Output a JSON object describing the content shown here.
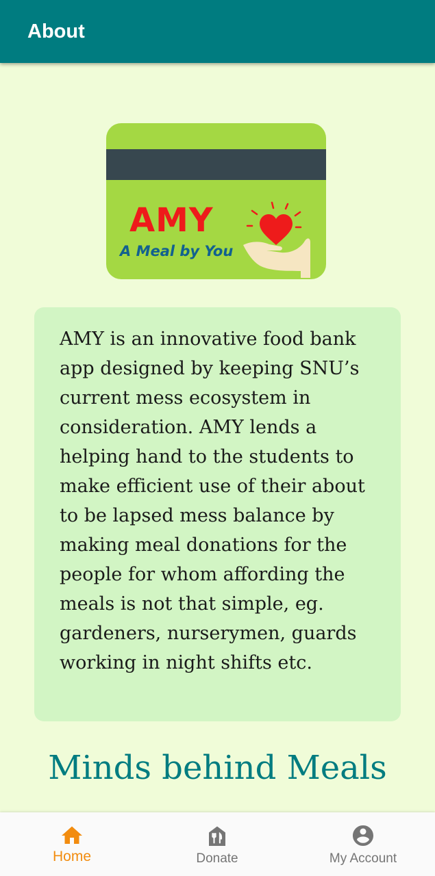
{
  "app_bar": {
    "title": "About"
  },
  "logo": {
    "name": "AMY",
    "tagline": "A Meal by You",
    "colors": {
      "card": "#a4d843",
      "stripe": "#37474f",
      "name": "#ee1b1b",
      "tagline": "#12618f",
      "heart": "#ee1b1b"
    },
    "icons": [
      "heart-in-hand-icon"
    ]
  },
  "description": {
    "text": "AMY is an innovative food bank app designed by keeping SNU’s current mess ecosystem in consideration. AMY lends a helping hand to the students to make efficient use of their about to be lapsed mess balance by making meal donations for the people for whom affording the meals is not that simple, eg. gardeners, nurserymen, guards working in night shifts etc."
  },
  "section": {
    "title": "Minds behind Meals"
  },
  "bottom_nav": {
    "items": [
      {
        "label": "Home",
        "icon": "home-icon",
        "active": true
      },
      {
        "label": "Donate",
        "icon": "donate-meal-icon",
        "active": false
      },
      {
        "label": "My Account",
        "icon": "account-circle-icon",
        "active": false
      }
    ],
    "active_color": "#f28c0f",
    "inactive_color": "#757575"
  },
  "theme": {
    "primary": "#007c80",
    "background": "#f0fcd8",
    "card": "#d2f5c4"
  }
}
